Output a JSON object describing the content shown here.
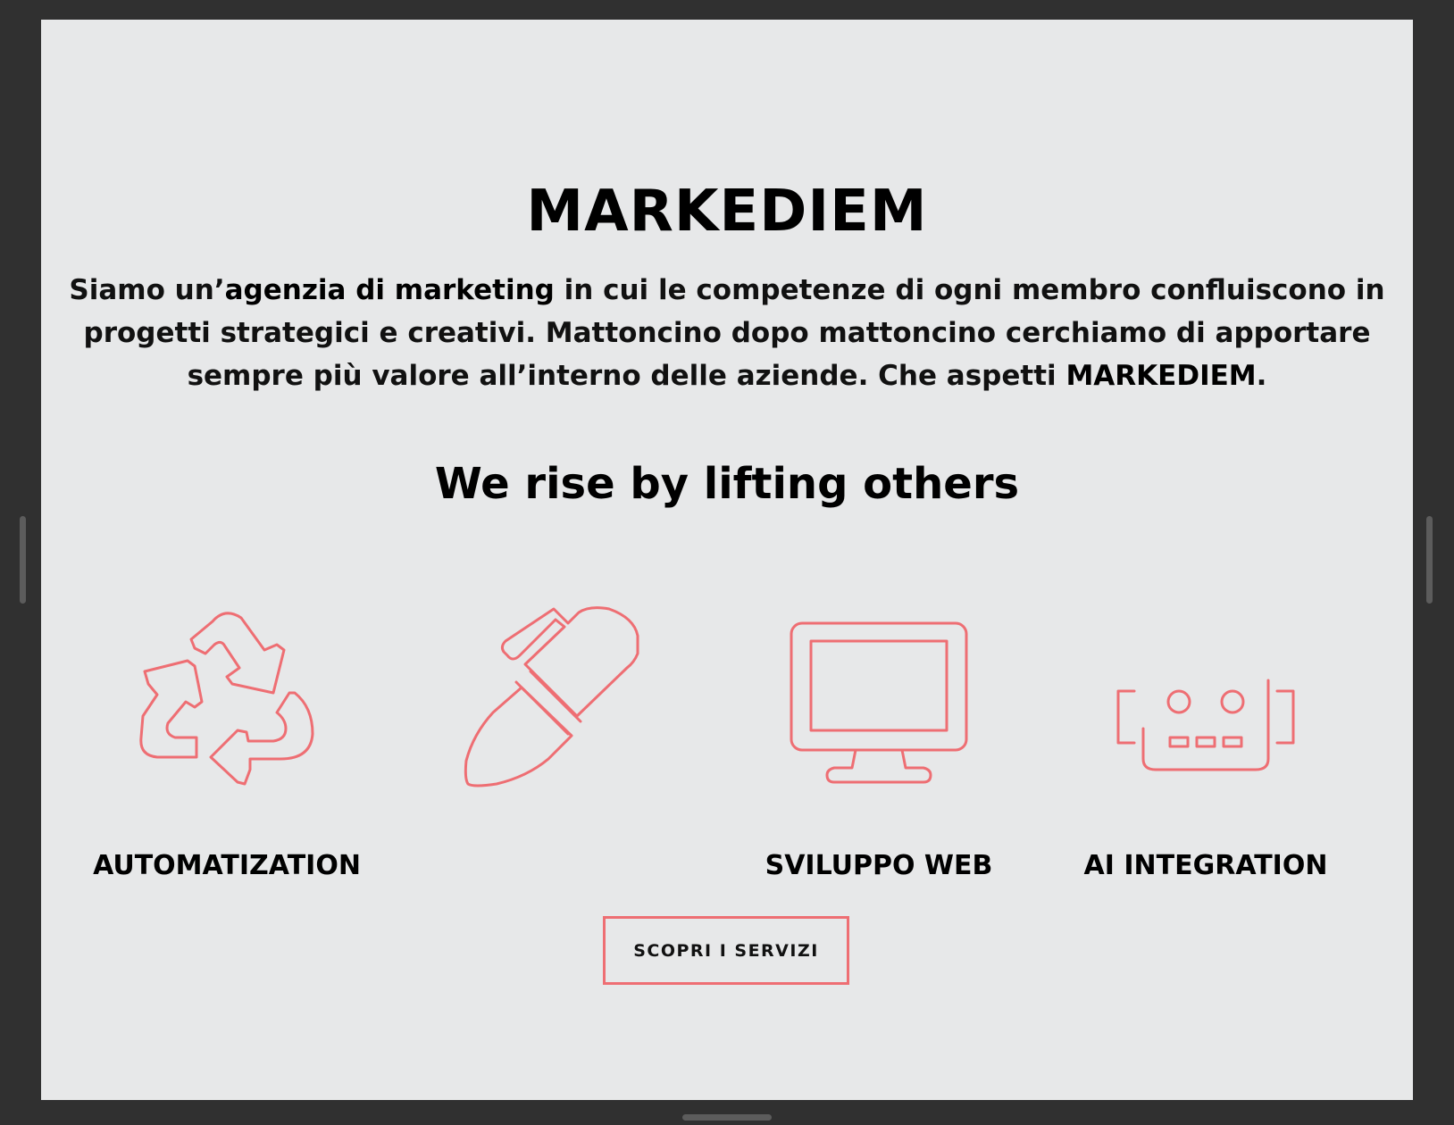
{
  "brand": {
    "title": "MARKEDIEM"
  },
  "intro": {
    "part1": "Siamo un’",
    "strong1": "agenzia di marketing",
    "part2": " in cui le competenze di ogni membro confluiscono in progetti strategici e creativi. Mattoncino dopo mattoncino cerchiamo di apportare sempre più valore all’interno delle aziende. Che aspetti ",
    "strong2": "MARKEDIEM",
    "part3": "."
  },
  "tagline": "We rise by lifting others",
  "services": [
    {
      "label": "AUTOMATIZATION",
      "icon": "recycle-icon"
    },
    {
      "label": "",
      "icon": "pen-icon"
    },
    {
      "label": "SVILUPPO WEB",
      "icon": "monitor-icon"
    },
    {
      "label": "AI INTEGRATION",
      "icon": "robot-icon"
    }
  ],
  "cta": {
    "label": "SCOPRI I SERVIZI"
  },
  "colors": {
    "accent": "#ee6e73",
    "background": "#e7e8e9",
    "frame": "#303030"
  }
}
